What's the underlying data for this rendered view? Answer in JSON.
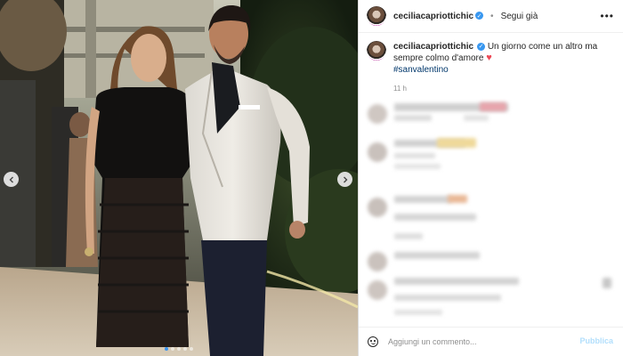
{
  "post": {
    "username": "ceciliacapriottichic",
    "verified_symbol": "✓",
    "separator": "•",
    "follow_label": "Segui già",
    "more_symbol": "•••",
    "caption_text": "Un giorno come un altro ma sempre colmo d'amore",
    "caption_emoji": "♥",
    "hashtag": "#sanvalentino",
    "time_ago": "11 h"
  },
  "carousel": {
    "slide_count": 5,
    "active_slide": 1
  },
  "comment_box": {
    "placeholder": "Aggiungi un commento...",
    "publish_label": "Pubblica"
  },
  "colors": {
    "accent": "#3897f0",
    "heart": "#ed4956",
    "publish_disabled": "#b2dffc"
  }
}
